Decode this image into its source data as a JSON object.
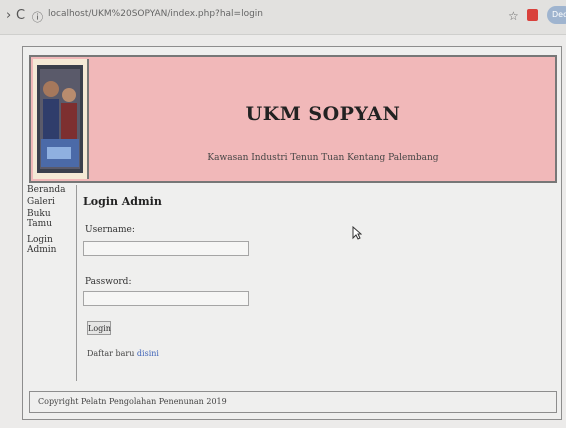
{
  "browser": {
    "url": "localhost/UKM%20SOPYAN/index.php?hal=login",
    "profile_label": "Dedi"
  },
  "header": {
    "title": "UKM SOPYAN",
    "subtitle": "Kawasan Industri Tenun Tuan Kentang Palembang"
  },
  "sidebar": {
    "items": [
      {
        "label": "Beranda"
      },
      {
        "label": "Galeri"
      },
      {
        "label": "Buku Tamu"
      },
      {
        "label": "Login Admin"
      }
    ]
  },
  "login": {
    "title": "Login Admin",
    "username_label": "Username:",
    "username_value": "",
    "password_label": "Password:",
    "password_value": "",
    "button_label": "Login",
    "register_text": "Daftar baru",
    "register_link": "disini"
  },
  "footer": {
    "text": "Copyright Pelatn Pengolahan Penenunan 2019"
  }
}
